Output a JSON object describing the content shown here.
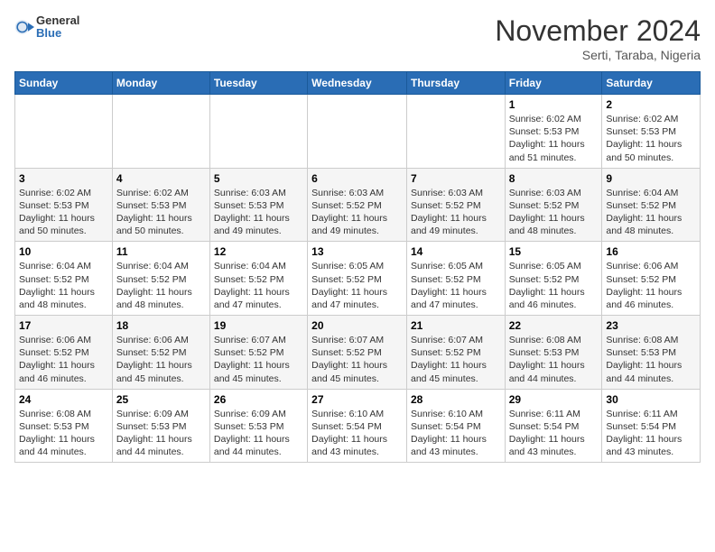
{
  "header": {
    "logo_general": "General",
    "logo_blue": "Blue",
    "month_title": "November 2024",
    "location": "Serti, Taraba, Nigeria"
  },
  "weekdays": [
    "Sunday",
    "Monday",
    "Tuesday",
    "Wednesday",
    "Thursday",
    "Friday",
    "Saturday"
  ],
  "weeks": [
    [
      {
        "day": "",
        "info": ""
      },
      {
        "day": "",
        "info": ""
      },
      {
        "day": "",
        "info": ""
      },
      {
        "day": "",
        "info": ""
      },
      {
        "day": "",
        "info": ""
      },
      {
        "day": "1",
        "info": "Sunrise: 6:02 AM\nSunset: 5:53 PM\nDaylight: 11 hours and 51 minutes."
      },
      {
        "day": "2",
        "info": "Sunrise: 6:02 AM\nSunset: 5:53 PM\nDaylight: 11 hours and 50 minutes."
      }
    ],
    [
      {
        "day": "3",
        "info": "Sunrise: 6:02 AM\nSunset: 5:53 PM\nDaylight: 11 hours and 50 minutes."
      },
      {
        "day": "4",
        "info": "Sunrise: 6:02 AM\nSunset: 5:53 PM\nDaylight: 11 hours and 50 minutes."
      },
      {
        "day": "5",
        "info": "Sunrise: 6:03 AM\nSunset: 5:53 PM\nDaylight: 11 hours and 49 minutes."
      },
      {
        "day": "6",
        "info": "Sunrise: 6:03 AM\nSunset: 5:52 PM\nDaylight: 11 hours and 49 minutes."
      },
      {
        "day": "7",
        "info": "Sunrise: 6:03 AM\nSunset: 5:52 PM\nDaylight: 11 hours and 49 minutes."
      },
      {
        "day": "8",
        "info": "Sunrise: 6:03 AM\nSunset: 5:52 PM\nDaylight: 11 hours and 48 minutes."
      },
      {
        "day": "9",
        "info": "Sunrise: 6:04 AM\nSunset: 5:52 PM\nDaylight: 11 hours and 48 minutes."
      }
    ],
    [
      {
        "day": "10",
        "info": "Sunrise: 6:04 AM\nSunset: 5:52 PM\nDaylight: 11 hours and 48 minutes."
      },
      {
        "day": "11",
        "info": "Sunrise: 6:04 AM\nSunset: 5:52 PM\nDaylight: 11 hours and 48 minutes."
      },
      {
        "day": "12",
        "info": "Sunrise: 6:04 AM\nSunset: 5:52 PM\nDaylight: 11 hours and 47 minutes."
      },
      {
        "day": "13",
        "info": "Sunrise: 6:05 AM\nSunset: 5:52 PM\nDaylight: 11 hours and 47 minutes."
      },
      {
        "day": "14",
        "info": "Sunrise: 6:05 AM\nSunset: 5:52 PM\nDaylight: 11 hours and 47 minutes."
      },
      {
        "day": "15",
        "info": "Sunrise: 6:05 AM\nSunset: 5:52 PM\nDaylight: 11 hours and 46 minutes."
      },
      {
        "day": "16",
        "info": "Sunrise: 6:06 AM\nSunset: 5:52 PM\nDaylight: 11 hours and 46 minutes."
      }
    ],
    [
      {
        "day": "17",
        "info": "Sunrise: 6:06 AM\nSunset: 5:52 PM\nDaylight: 11 hours and 46 minutes."
      },
      {
        "day": "18",
        "info": "Sunrise: 6:06 AM\nSunset: 5:52 PM\nDaylight: 11 hours and 45 minutes."
      },
      {
        "day": "19",
        "info": "Sunrise: 6:07 AM\nSunset: 5:52 PM\nDaylight: 11 hours and 45 minutes."
      },
      {
        "day": "20",
        "info": "Sunrise: 6:07 AM\nSunset: 5:52 PM\nDaylight: 11 hours and 45 minutes."
      },
      {
        "day": "21",
        "info": "Sunrise: 6:07 AM\nSunset: 5:52 PM\nDaylight: 11 hours and 45 minutes."
      },
      {
        "day": "22",
        "info": "Sunrise: 6:08 AM\nSunset: 5:53 PM\nDaylight: 11 hours and 44 minutes."
      },
      {
        "day": "23",
        "info": "Sunrise: 6:08 AM\nSunset: 5:53 PM\nDaylight: 11 hours and 44 minutes."
      }
    ],
    [
      {
        "day": "24",
        "info": "Sunrise: 6:08 AM\nSunset: 5:53 PM\nDaylight: 11 hours and 44 minutes."
      },
      {
        "day": "25",
        "info": "Sunrise: 6:09 AM\nSunset: 5:53 PM\nDaylight: 11 hours and 44 minutes."
      },
      {
        "day": "26",
        "info": "Sunrise: 6:09 AM\nSunset: 5:53 PM\nDaylight: 11 hours and 44 minutes."
      },
      {
        "day": "27",
        "info": "Sunrise: 6:10 AM\nSunset: 5:54 PM\nDaylight: 11 hours and 43 minutes."
      },
      {
        "day": "28",
        "info": "Sunrise: 6:10 AM\nSunset: 5:54 PM\nDaylight: 11 hours and 43 minutes."
      },
      {
        "day": "29",
        "info": "Sunrise: 6:11 AM\nSunset: 5:54 PM\nDaylight: 11 hours and 43 minutes."
      },
      {
        "day": "30",
        "info": "Sunrise: 6:11 AM\nSunset: 5:54 PM\nDaylight: 11 hours and 43 minutes."
      }
    ]
  ]
}
